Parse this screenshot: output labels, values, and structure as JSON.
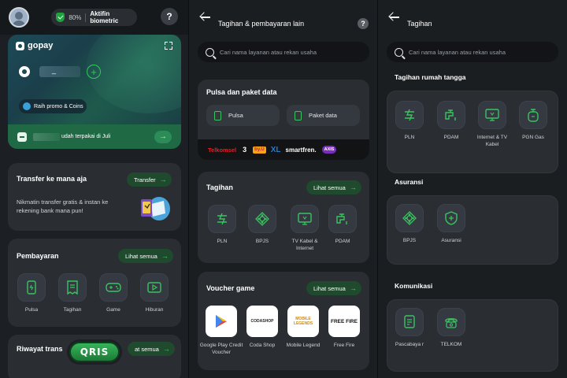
{
  "screen1": {
    "biometric": {
      "percent": "80%",
      "label": "Aktifin biometric"
    },
    "help": "?",
    "gopay": {
      "brand": "gopay",
      "balance_placeholder": "_",
      "plus": "+",
      "promo_label": "Raih promo & Coins",
      "spent_text": "udah terpakai di Juli",
      "arrow": "→"
    },
    "transfer": {
      "title": "Transfer ke mana aja",
      "button": "Transfer",
      "arrow": "→",
      "description": "Nikmatin transfer gratis & instan ke rekening bank mana pun!"
    },
    "pembayaran": {
      "title": "Pembayaran",
      "see_all": "Lihat semua",
      "arrow": "→",
      "items": [
        {
          "label": "Pulsa",
          "icon": "phone-icon"
        },
        {
          "label": "Tagihan",
          "icon": "receipt-icon"
        },
        {
          "label": "Game",
          "icon": "gamepad-icon"
        },
        {
          "label": "Hiburan",
          "icon": "play-icon"
        }
      ]
    },
    "riwayat": {
      "title": "Riwayat trans",
      "see_all": "at semua",
      "arrow": "→"
    },
    "qris": "QRIS"
  },
  "screen2": {
    "title": "Tagihan & pembayaran lain",
    "help": "?",
    "search_placeholder": "Cari nama layanan atau rekan usaha",
    "pulsa_section": {
      "title": "Pulsa dan paket data",
      "buttons": [
        "Pulsa",
        "Paket data"
      ],
      "operators": [
        "Telkomsel",
        "3",
        "by.U",
        "XL",
        "smartfren.",
        "AXIS"
      ]
    },
    "tagihan_section": {
      "title": "Tagihan",
      "see_all": "Lihat semua",
      "arrow": "→",
      "items": [
        {
          "label": "PLN",
          "icon": "electricity-icon"
        },
        {
          "label": "BPJS",
          "icon": "bpjs-icon"
        },
        {
          "label": "TV Kabel & Internet",
          "icon": "tv-icon"
        },
        {
          "label": "PDAM",
          "icon": "water-tap-icon"
        }
      ]
    },
    "voucher_section": {
      "title": "Voucher game",
      "see_all": "Lihat semua",
      "arrow": "→",
      "items": [
        {
          "label": "Google Play Credit Voucher",
          "logo": "▶"
        },
        {
          "label": "Coda Shop",
          "logo": "CODASHOP"
        },
        {
          "label": "Mobile Legend",
          "logo": "MOBILE LEGENDS"
        },
        {
          "label": "Free Fire",
          "logo": "FREE FIRE"
        }
      ]
    }
  },
  "screen3": {
    "title": "Tagihan",
    "search_placeholder": "Cari nama layanan atau rekan usaha",
    "rumah_tangga": {
      "title": "Tagihan rumah tangga",
      "items": [
        {
          "label": "PLN",
          "icon": "electricity-icon"
        },
        {
          "label": "PDAM",
          "icon": "water-tap-icon"
        },
        {
          "label": "Internet & TV Kabel",
          "icon": "tv-icon"
        },
        {
          "label": "PGN Gas",
          "icon": "gas-cylinder-icon"
        }
      ]
    },
    "asuransi": {
      "title": "Asuransi",
      "items": [
        {
          "label": "BPJS",
          "icon": "bpjs-icon"
        },
        {
          "label": "Asuransi",
          "icon": "shield-plus-icon"
        }
      ]
    },
    "komunikasi": {
      "title": "Komunikasi",
      "items": [
        {
          "label": "Pascabaya r",
          "icon": "bill-icon"
        },
        {
          "label": "TELKOM",
          "icon": "telephone-icon"
        }
      ]
    }
  },
  "colors": {
    "accent": "#2ecc55",
    "card": "#2a2d32",
    "background": "#1b1e21",
    "pill": "#1f4a2d"
  }
}
